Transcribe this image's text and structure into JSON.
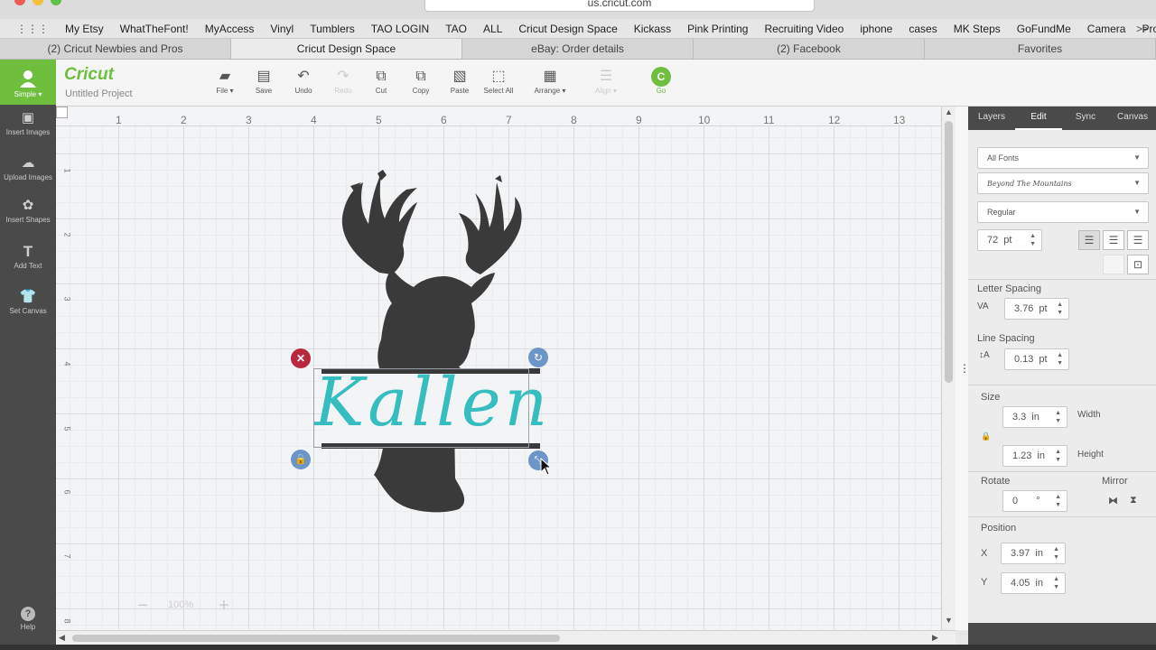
{
  "browser": {
    "url": "us.cricut.com",
    "bookmarks": [
      "My Etsy",
      "WhatTheFont!",
      "MyAccess",
      "Vinyl",
      "Tumblers",
      "TAO LOGIN",
      "TAO",
      "ALL",
      "Cricut Design Space",
      "Kickass",
      "Pink Printing",
      "Recruiting Video",
      "iphone",
      "cases",
      "MK Steps",
      "GoFundMe",
      "Camera",
      "ProPay"
    ],
    "more": ">>",
    "tabs": [
      {
        "label": "(2) Cricut Newbies and Pros",
        "active": false
      },
      {
        "label": "Cricut Design Space",
        "active": true
      },
      {
        "label": "eBay: Order details",
        "active": false
      },
      {
        "label": "(2) Facebook",
        "active": false
      },
      {
        "label": "Favorites",
        "active": false
      }
    ]
  },
  "rail": {
    "simple": "Simple",
    "items": [
      {
        "label": "Insert Images",
        "icon": "image-icon"
      },
      {
        "label": "Upload Images",
        "icon": "cloud-upload-icon"
      },
      {
        "label": "Insert Shapes",
        "icon": "shapes-icon"
      },
      {
        "label": "Add Text",
        "icon": "text-icon"
      },
      {
        "label": "Set Canvas",
        "icon": "shirt-icon"
      }
    ],
    "help": "Help"
  },
  "header": {
    "logo": "Cricut",
    "project": "Untitled Project",
    "tools": [
      {
        "label": "File",
        "icon": "folder-icon",
        "enabled": true
      },
      {
        "label": "Save",
        "icon": "save-icon",
        "enabled": true
      },
      {
        "label": "Undo",
        "icon": "undo-icon",
        "enabled": true
      },
      {
        "label": "Redo",
        "icon": "redo-icon",
        "enabled": false
      },
      {
        "label": "Cut",
        "icon": "cut-icon",
        "enabled": true
      },
      {
        "label": "Copy",
        "icon": "copy-icon",
        "enabled": true
      },
      {
        "label": "Paste",
        "icon": "paste-icon",
        "enabled": true
      },
      {
        "label": "Select All",
        "icon": "select-all-icon",
        "enabled": true
      },
      {
        "label": "Arrange",
        "icon": "arrange-icon",
        "enabled": true
      },
      {
        "label": "Align",
        "icon": "align-icon",
        "enabled": false
      },
      {
        "label": "Go",
        "icon": "go-icon",
        "enabled": true
      }
    ]
  },
  "canvas": {
    "ruler_top": [
      "1",
      "2",
      "3",
      "4",
      "5",
      "6",
      "7",
      "8",
      "9",
      "10",
      "11",
      "12",
      "13"
    ],
    "ruler_left": [
      "1",
      "2",
      "3",
      "4",
      "5",
      "6",
      "7",
      "8"
    ],
    "text": "Kallen",
    "zoom": "100%",
    "text_color": "#35bdbf",
    "silhouette_color": "#3a3a3a"
  },
  "panel": {
    "tabs": [
      {
        "label": "Layers",
        "active": false
      },
      {
        "label": "Edit",
        "active": true
      },
      {
        "label": "Sync",
        "active": false
      },
      {
        "label": "Canvas",
        "active": false
      }
    ],
    "font_filter": "All Fonts",
    "font_name": "Beyond The Mountains",
    "font_style": "Regular",
    "font_size": "72",
    "font_size_unit": "pt",
    "letter_spacing_label": "Letter Spacing",
    "letter_spacing": "3.76",
    "line_spacing_label": "Line Spacing",
    "line_spacing": "0.13",
    "spacing_unit": "pt",
    "size_label": "Size",
    "width": "3.3",
    "width_label": "Width",
    "height": "1.23",
    "height_label": "Height",
    "unit_in": "in",
    "rotate_label": "Rotate",
    "rotate": "0",
    "rotate_unit": "°",
    "mirror_label": "Mirror",
    "position_label": "Position",
    "x_label": "X",
    "x": "3.97",
    "y_label": "Y",
    "y": "4.05"
  }
}
